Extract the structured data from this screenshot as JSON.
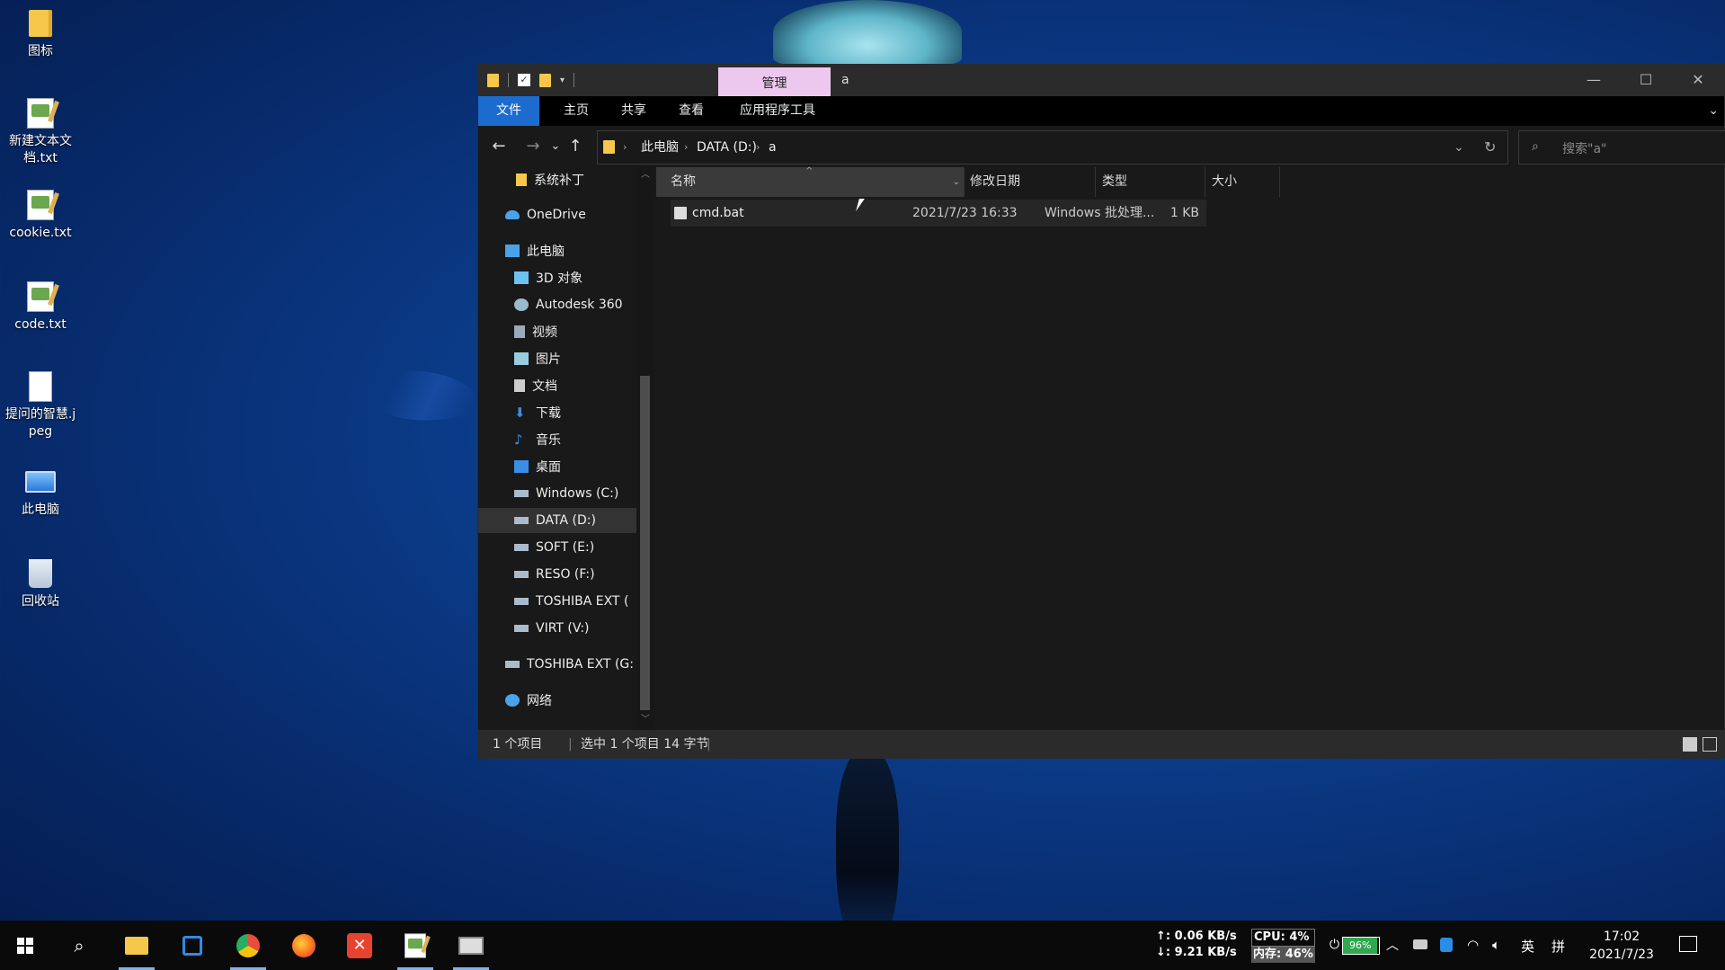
{
  "desktop": {
    "icons": [
      {
        "label": "图标",
        "icon": "folder-icon"
      },
      {
        "label": "新建文本文档.txt",
        "icon": "text-file-icon"
      },
      {
        "label": "cookie.txt",
        "icon": "text-file-icon"
      },
      {
        "label": "code.txt",
        "icon": "text-file-icon"
      },
      {
        "label": "提问的智慧.jpeg",
        "icon": "image-file-icon"
      },
      {
        "label": "此电脑",
        "icon": "computer-icon"
      },
      {
        "label": "回收站",
        "icon": "recycle-bin-icon"
      }
    ]
  },
  "window": {
    "context_tab": "管理",
    "title": "a",
    "controls": {
      "minimize": "—",
      "maximize": "☐",
      "close": "✕"
    }
  },
  "ribbon": {
    "tabs": [
      "文件",
      "主页",
      "共享",
      "查看",
      "应用程序工具"
    ],
    "active_tab": "文件",
    "expand_icon": "⌄"
  },
  "navigation": {
    "back": "←",
    "forward": "→",
    "recent": "⌄",
    "up": "↑"
  },
  "address": {
    "crumbs": [
      "此电脑",
      "DATA (D:)",
      "a"
    ],
    "separator": "›",
    "dropdown": "⌄",
    "refresh": "↻"
  },
  "search": {
    "icon": "⌕",
    "placeholder": "搜索\"a\""
  },
  "nav_pane": {
    "items": [
      {
        "label": "系统补丁",
        "icon": "folder-icon",
        "color": "#f5c84b"
      },
      {
        "label": "OneDrive",
        "icon": "cloud-icon",
        "color": "#4aa3e8"
      },
      {
        "label": "此电脑",
        "icon": "computer-icon",
        "color": "#4aa3e8"
      },
      {
        "label": "3D 对象",
        "icon": "cube-icon",
        "color": "#6cc3f0"
      },
      {
        "label": "Autodesk 360",
        "icon": "cloud-drive-icon",
        "color": "#9bc"
      },
      {
        "label": "视频",
        "icon": "video-icon",
        "color": "#9ab"
      },
      {
        "label": "图片",
        "icon": "picture-icon",
        "color": "#9cd"
      },
      {
        "label": "文档",
        "icon": "document-icon",
        "color": "#ccc"
      },
      {
        "label": "下载",
        "icon": "download-icon",
        "color": "#3a8ee6"
      },
      {
        "label": "音乐",
        "icon": "music-icon",
        "color": "#3a8ee6"
      },
      {
        "label": "桌面",
        "icon": "desktop-icon",
        "color": "#3a8ee6"
      },
      {
        "label": "Windows (C:)",
        "icon": "drive-icon",
        "color": "#aab"
      },
      {
        "label": "DATA (D:)",
        "icon": "drive-icon",
        "color": "#aab"
      },
      {
        "label": "SOFT (E:)",
        "icon": "drive-icon",
        "color": "#aab"
      },
      {
        "label": "RESO (F:)",
        "icon": "drive-icon",
        "color": "#aab"
      },
      {
        "label": "TOSHIBA EXT (",
        "icon": "drive-icon",
        "color": "#aab"
      },
      {
        "label": "VIRT (V:)",
        "icon": "drive-icon",
        "color": "#aab"
      },
      {
        "label": "TOSHIBA EXT (G:",
        "icon": "drive-icon",
        "color": "#aab"
      },
      {
        "label": "网络",
        "icon": "network-icon",
        "color": "#4aa3e8"
      }
    ],
    "selected": "DATA (D:)"
  },
  "columns": {
    "name": "名称",
    "date": "修改日期",
    "type": "类型",
    "size": "大小"
  },
  "files": [
    {
      "name": "cmd.bat",
      "date": "2021/7/23 16:33",
      "type": "Windows 批处理...",
      "size": "1 KB"
    }
  ],
  "status": {
    "count": "1 个项目",
    "selected": "选中 1 个项目 14 字节"
  },
  "taskbar": {
    "apps": [
      "start-icon",
      "search-icon",
      "file-explorer-icon",
      "app-icon",
      "chrome-icon",
      "firefox-icon",
      "xmind-icon",
      "notepad-icon",
      "cmd-icon"
    ],
    "net_up": "↑: 0.06 KB/s",
    "net_down": "↓: 9.21 KB/s",
    "cpu": "CPU: 4%",
    "mem": "内存: 46%",
    "battery": "96%",
    "ime": "英",
    "ime2": "拼",
    "time": "17:02",
    "date": "2021/7/23"
  }
}
